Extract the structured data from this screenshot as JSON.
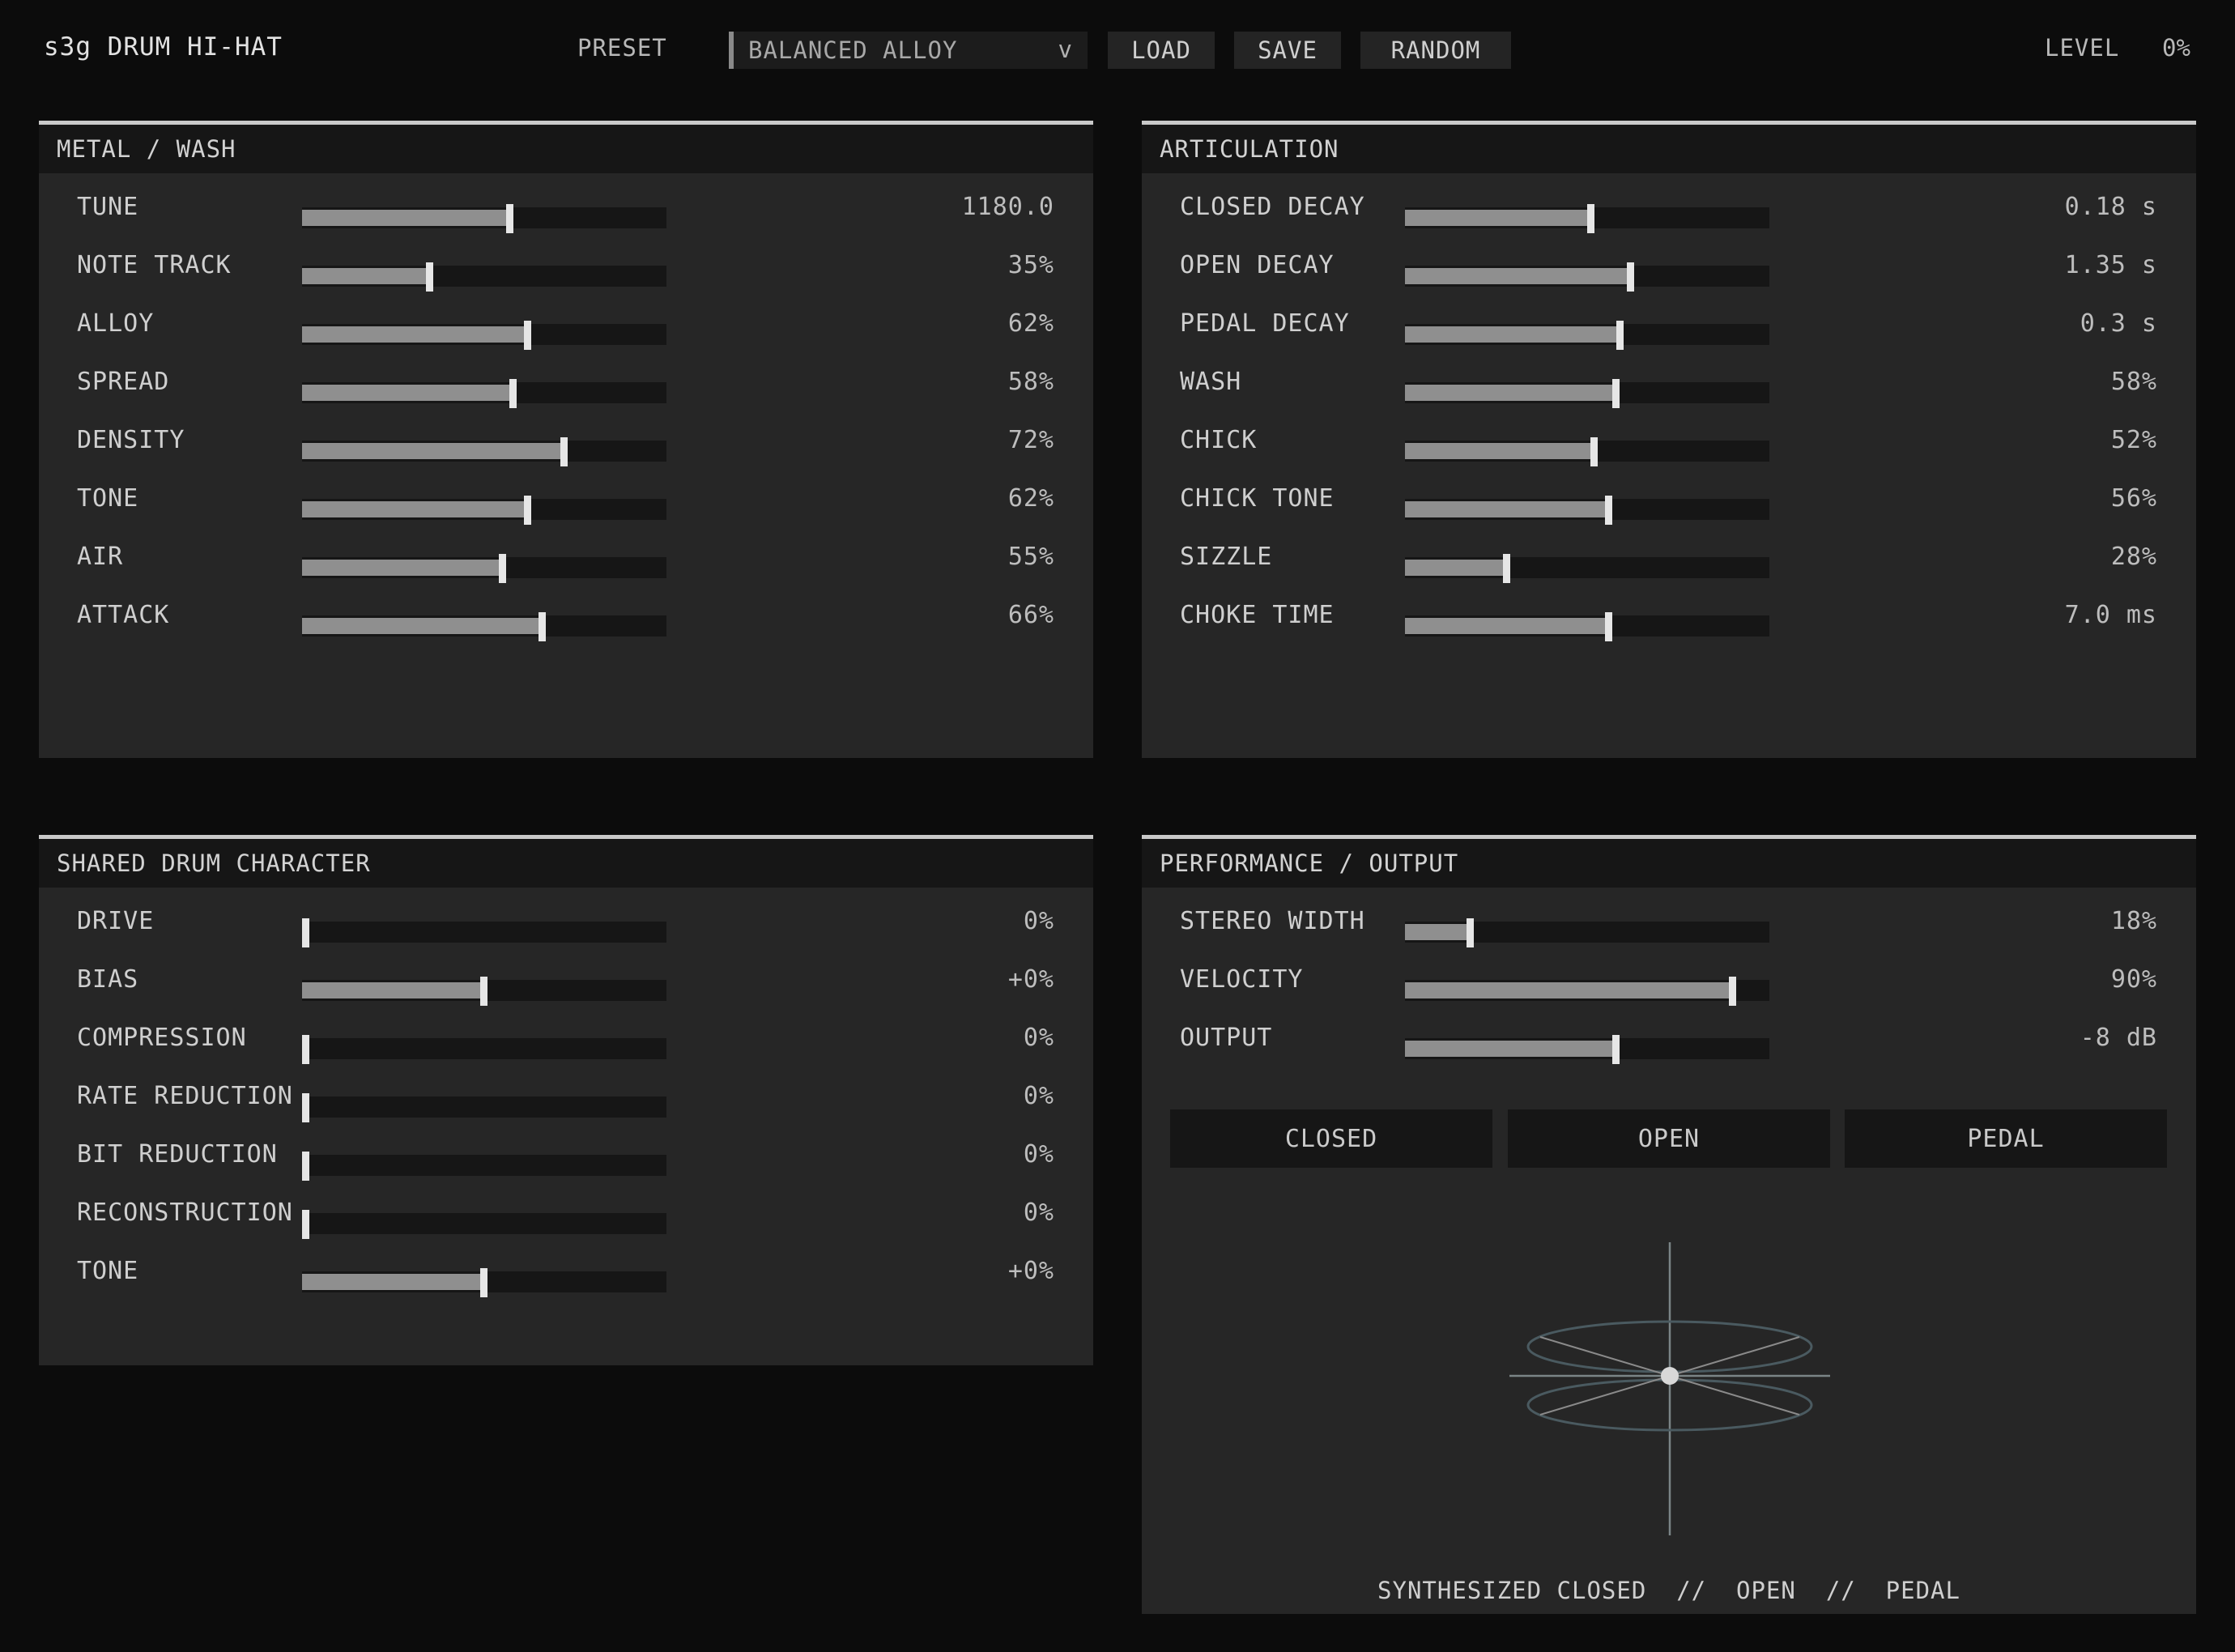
{
  "header": {
    "title": "s3g DRUM HI-HAT",
    "preset_label": "PRESET",
    "preset_value": "BALANCED ALLOY",
    "preset_chevron": "v",
    "load_label": "LOAD",
    "save_label": "SAVE",
    "random_label": "RANDOM",
    "level_label": "LEVEL",
    "level_value": "0%"
  },
  "panels": {
    "metal": {
      "title": "METAL / WASH",
      "params": [
        {
          "label": "TUNE",
          "value": "1180.0",
          "fill": 0.57
        },
        {
          "label": "NOTE TRACK",
          "value": "35%",
          "fill": 0.35
        },
        {
          "label": "ALLOY",
          "value": "62%",
          "fill": 0.62
        },
        {
          "label": "SPREAD",
          "value": "58%",
          "fill": 0.58
        },
        {
          "label": "DENSITY",
          "value": "72%",
          "fill": 0.72
        },
        {
          "label": "TONE",
          "value": "62%",
          "fill": 0.62
        },
        {
          "label": "AIR",
          "value": "55%",
          "fill": 0.55
        },
        {
          "label": "ATTACK",
          "value": "66%",
          "fill": 0.66
        }
      ]
    },
    "articulation": {
      "title": "ARTICULATION",
      "params": [
        {
          "label": "CLOSED DECAY",
          "value": "0.18 s",
          "fill": 0.51
        },
        {
          "label": "OPEN DECAY",
          "value": "1.35 s",
          "fill": 0.62
        },
        {
          "label": "PEDAL DECAY",
          "value": "0.3 s",
          "fill": 0.59
        },
        {
          "label": "WASH",
          "value": "58%",
          "fill": 0.58
        },
        {
          "label": "CHICK",
          "value": "52%",
          "fill": 0.52
        },
        {
          "label": "CHICK TONE",
          "value": "56%",
          "fill": 0.56
        },
        {
          "label": "SIZZLE",
          "value": "28%",
          "fill": 0.28
        },
        {
          "label": "CHOKE TIME",
          "value": "7.0 ms",
          "fill": 0.56
        }
      ]
    },
    "shared": {
      "title": "SHARED DRUM CHARACTER",
      "params": [
        {
          "label": "DRIVE",
          "value": "0%",
          "fill": 0.0
        },
        {
          "label": "BIAS",
          "value": "+0%",
          "fill": 0.5
        },
        {
          "label": "COMPRESSION",
          "value": "0%",
          "fill": 0.0
        },
        {
          "label": "RATE REDUCTION",
          "value": "0%",
          "fill": 0.0
        },
        {
          "label": "BIT REDUCTION",
          "value": "0%",
          "fill": 0.0
        },
        {
          "label": "RECONSTRUCTION",
          "value": "0%",
          "fill": 0.0
        },
        {
          "label": "TONE",
          "value": "+0%",
          "fill": 0.5
        }
      ]
    },
    "performance": {
      "title": "PERFORMANCE / OUTPUT",
      "params": [
        {
          "label": "STEREO WIDTH",
          "value": "18%",
          "fill": 0.18
        },
        {
          "label": "VELOCITY",
          "value": "90%",
          "fill": 0.9
        },
        {
          "label": "OUTPUT",
          "value": "-8 dB",
          "fill": 0.58
        }
      ],
      "modes": [
        "CLOSED",
        "OPEN",
        "PEDAL"
      ],
      "footer": "SYNTHESIZED CLOSED  //  OPEN  //  PEDAL"
    }
  },
  "colors": {
    "background": "#0c0c0c",
    "panel": "#262626",
    "panel_header": "#161616",
    "fill": "#8f8f8f",
    "thumb": "#e6e6e6",
    "viz_ring": "#4a5a60"
  },
  "icons": {
    "chevron": "chevron-down-icon",
    "visualizer": "hihat-visualizer-icon"
  }
}
